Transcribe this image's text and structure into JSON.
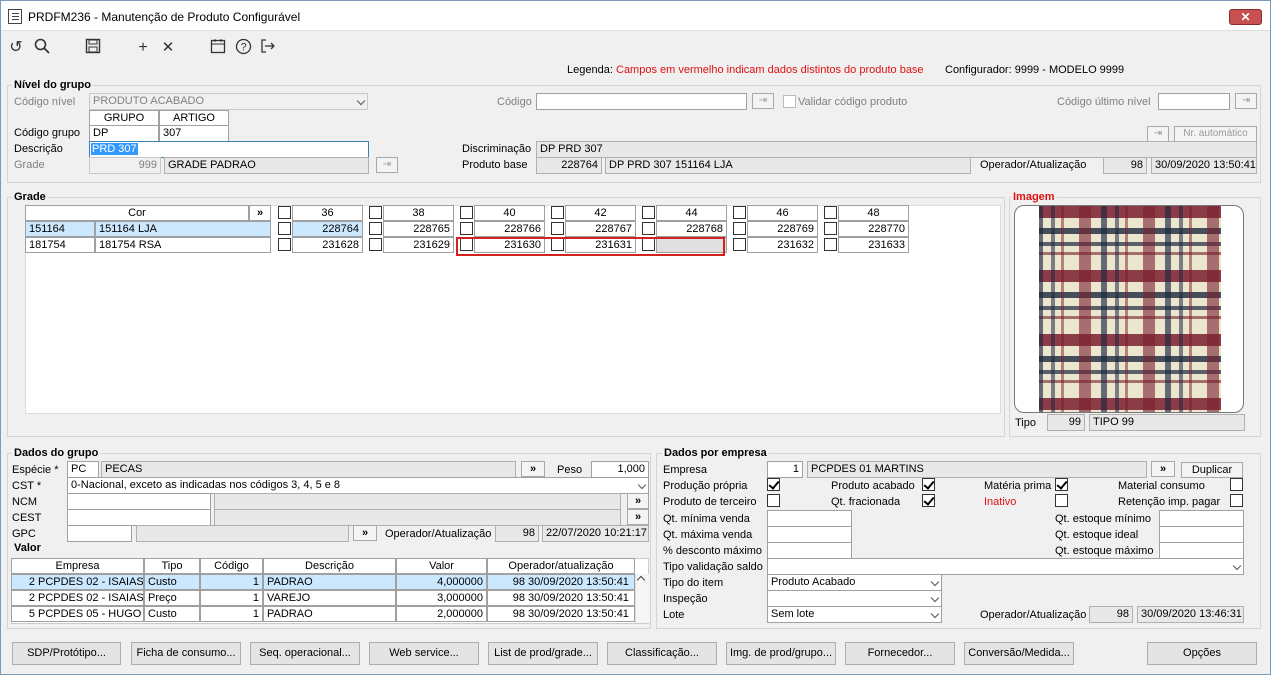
{
  "window": {
    "title": "PRDFM236 - Manutenção de Produto Configurável",
    "close": "✕"
  },
  "toolbar": {
    "undo": "↺",
    "search": "🔍",
    "save": "💾",
    "add": "+",
    "cancel": "✕",
    "calendar": "📅",
    "help": "?",
    "exit": "↦"
  },
  "legend": {
    "label": "Legenda:",
    "text": "Campos em vermelho indicam dados distintos do produto base"
  },
  "configurador": "Configurador: 9999 - MODELO 9999",
  "nivel": {
    "title": "Nível do grupo",
    "codigo_nivel_label": "Código nível",
    "codigo_nivel_value": "PRODUTO ACABADO",
    "codigo_label": "Código",
    "codigo_value": "",
    "validar_label": "Validar código produto",
    "codigo_ultimo_label": "Código último nível",
    "codigo_ultimo_value": "",
    "grupo_header": "GRUPO",
    "artigo_header": "ARTIGO",
    "codigo_grupo_label": "Código grupo",
    "grupo_value": "DP",
    "artigo_value": "307",
    "descricao_label": "Descrição",
    "descricao_value": "PRD 307",
    "grade_label": "Grade",
    "grade_num": "999",
    "grade_name": "GRADE PADRAO",
    "nr_automatico": "Nr. automático",
    "discriminacao_label": "Discriminação",
    "discriminacao_value": "DP PRD 307",
    "produto_base_label": "Produto base",
    "produto_base_num": "228764",
    "produto_base_name": "DP PRD 307 151164 LJA",
    "operador_label": "Operador/Atualização",
    "operador_num": "98",
    "operador_date": "30/09/2020 13:50:41"
  },
  "grade": {
    "title": "Grade",
    "cor_header": "Cor",
    "expand": "»",
    "sizes": [
      "36",
      "38",
      "40",
      "42",
      "44",
      "46",
      "48"
    ],
    "rows": [
      {
        "code": "151164",
        "name": "151164 LJA",
        "values": [
          "228764",
          "228765",
          "228766",
          "228767",
          "228768",
          "228769",
          "228770"
        ]
      },
      {
        "code": "181754",
        "name": "181754 RSA",
        "values": [
          "231628",
          "231629",
          "231630",
          "231631",
          "",
          "231632",
          "231633"
        ]
      }
    ]
  },
  "imagem": {
    "title": "Imagem",
    "tipo_label": "Tipo",
    "tipo_num": "99",
    "tipo_name": "TIPO 99"
  },
  "dados_grupo": {
    "title": "Dados do grupo",
    "especie_label": "Espécie *",
    "especie_code": "PC",
    "especie_name": "PECAS",
    "peso_label": "Peso",
    "peso_value": "1,000",
    "cst_label": "CST *",
    "cst_value": "0-Nacional, exceto as indicadas nos códigos 3, 4, 5 e 8",
    "ncm_label": "NCM",
    "cest_label": "CEST",
    "gpc_label": "GPC",
    "operador_label": "Operador/Atualização",
    "operador_num": "98",
    "operador_date": "22/07/2020 10:21:17"
  },
  "valor": {
    "title": "Valor",
    "headers": [
      "Empresa",
      "Tipo",
      "Código",
      "Descrição",
      "Valor",
      "Operador/atualização"
    ],
    "rows": [
      {
        "num": "2",
        "empresa": "PCPDES 02 - ISAIAS",
        "tipo": "Custo",
        "codigo": "1",
        "descricao": "PADRAO",
        "valor": "4,000000",
        "op": "98",
        "data": "30/09/2020 13:50:41"
      },
      {
        "num": "2",
        "empresa": "PCPDES 02 - ISAIAS",
        "tipo": "Preço",
        "codigo": "1",
        "descricao": "VAREJO",
        "valor": "3,000000",
        "op": "98",
        "data": "30/09/2020 13:50:41"
      },
      {
        "num": "5",
        "empresa": "PCPDES 05 - HUGO",
        "tipo": "Custo",
        "codigo": "1",
        "descricao": "PADRAO",
        "valor": "2,000000",
        "op": "98",
        "data": "30/09/2020 13:50:41"
      }
    ]
  },
  "dados_empresa": {
    "title": "Dados por empresa",
    "empresa_label": "Empresa",
    "empresa_num": "1",
    "empresa_name": "PCPDES 01 MARTINS",
    "duplicar": "Duplicar",
    "producao_propria": "Produção própria",
    "produto_acabado": "Produto acabado",
    "materia_prima": "Matéria prima",
    "material_consumo": "Material consumo",
    "produto_terceiro": "Produto de terceiro",
    "qt_fracionada": "Qt. fracionada",
    "inativo": "Inativo",
    "retencao": "Retenção imp. pagar",
    "qt_min_venda": "Qt. mínima venda",
    "qt_max_venda": "Qt. máxima venda",
    "pct_desconto": "% desconto máximo",
    "qt_est_min": "Qt. estoque mínimo",
    "qt_est_ideal": "Qt. estoque ideal",
    "qt_est_max": "Qt. estoque máximo",
    "tipo_validacao": "Tipo validação saldo",
    "tipo_item_label": "Tipo do item",
    "tipo_item_value": "Produto Acabado",
    "inspecao_label": "Inspeção",
    "lote_label": "Lote",
    "lote_value": "Sem lote",
    "operador_label": "Operador/Atualização",
    "operador_num": "98",
    "operador_date": "30/09/2020 13:46:31"
  },
  "buttons": [
    "SDP/Protótipo...",
    "Ficha de consumo...",
    "Seq. operacional...",
    "Web service...",
    "List de prod/grade...",
    "Classificação...",
    "Img. de prod/grupo...",
    "Fornecedor...",
    "Conversão/Medida...",
    "Opções"
  ]
}
